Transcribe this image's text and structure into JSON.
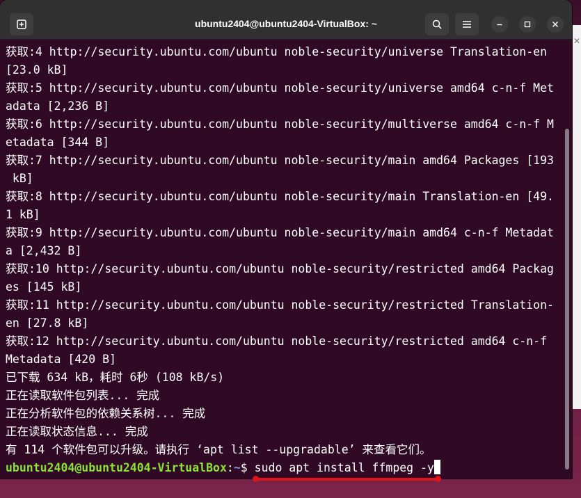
{
  "window": {
    "title": "ubuntu2404@ubuntu2404-VirtualBox: ~"
  },
  "titlebar": {
    "icons": [
      "new-tab-icon",
      "search-icon",
      "menu-icon",
      "minimize-icon",
      "maximize-icon",
      "close-icon"
    ]
  },
  "terminal": {
    "lines": [
      "获取:4 http://security.ubuntu.com/ubuntu noble-security/universe Translation-en",
      "[23.0 kB]",
      "获取:5 http://security.ubuntu.com/ubuntu noble-security/universe amd64 c-n-f Met",
      "adata [2,236 B]",
      "获取:6 http://security.ubuntu.com/ubuntu noble-security/multiverse amd64 c-n-f M",
      "etadata [344 B]",
      "获取:7 http://security.ubuntu.com/ubuntu noble-security/main amd64 Packages [193",
      " kB]",
      "获取:8 http://security.ubuntu.com/ubuntu noble-security/main Translation-en [49.",
      "1 kB]",
      "获取:9 http://security.ubuntu.com/ubuntu noble-security/main amd64 c-n-f Metadat",
      "a [2,432 B]",
      "获取:10 http://security.ubuntu.com/ubuntu noble-security/restricted amd64 Packag",
      "es [145 kB]",
      "获取:11 http://security.ubuntu.com/ubuntu noble-security/restricted Translation-",
      "en [27.8 kB]",
      "获取:12 http://security.ubuntu.com/ubuntu noble-security/restricted amd64 c-n-f",
      "Metadata [420 B]",
      "已下载 634 kB，耗时 6秒 (108 kB/s)",
      "正在读取软件包列表... 完成",
      "正在分析软件包的依赖关系树... 完成",
      "正在读取状态信息... 完成",
      "有 114 个软件包可以升级。请执行 ‘apt list --upgradable’ 来查看它们。"
    ],
    "prompt": {
      "user_host": "ubuntu2404@ubuntu2404-VirtualBox",
      "separator": ":",
      "path": "~",
      "symbol": "$ ",
      "command": "sudo apt install ffmpeg -y"
    }
  },
  "colors": {
    "terminal_bg": "#300a24",
    "prompt_user": "#8ae234",
    "prompt_path": "#729fcf",
    "annotation": "#e0121c"
  }
}
